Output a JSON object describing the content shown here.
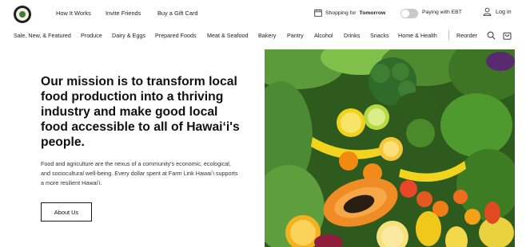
{
  "nav": {
    "top_links": [
      "How It Works",
      "Invite Friends",
      "Buy a Gift Card"
    ],
    "shopping_prefix": "Shopping for",
    "shopping_day": "Tomorrow",
    "ebt_label": "Paying with EBT",
    "login_label": "Log in"
  },
  "categories": [
    "Sale, New, & Featured",
    "Produce",
    "Dairy & Eggs",
    "Prepared Foods",
    "Meat & Seafood",
    "Bakery",
    "Pantry",
    "Alcohol",
    "Drinks",
    "Snacks",
    "Home & Health"
  ],
  "reorder_label": "Reorder",
  "hero": {
    "title": "Our mission is to transform local food production into a thriving industry and make good local food accessible to all of Hawaiʻi's people.",
    "body": "Food and agriculture are the nexus of a community's economic, ecological, and sociocultural well-being. Every dollar spent at Farm Link Hawaiʻi supports a more resilient Hawaiʻi.",
    "button_label": "About Us"
  },
  "icons": {
    "calendar": "calendar-icon",
    "user": "user-icon",
    "search": "search-icon",
    "cart": "cart-icon"
  }
}
